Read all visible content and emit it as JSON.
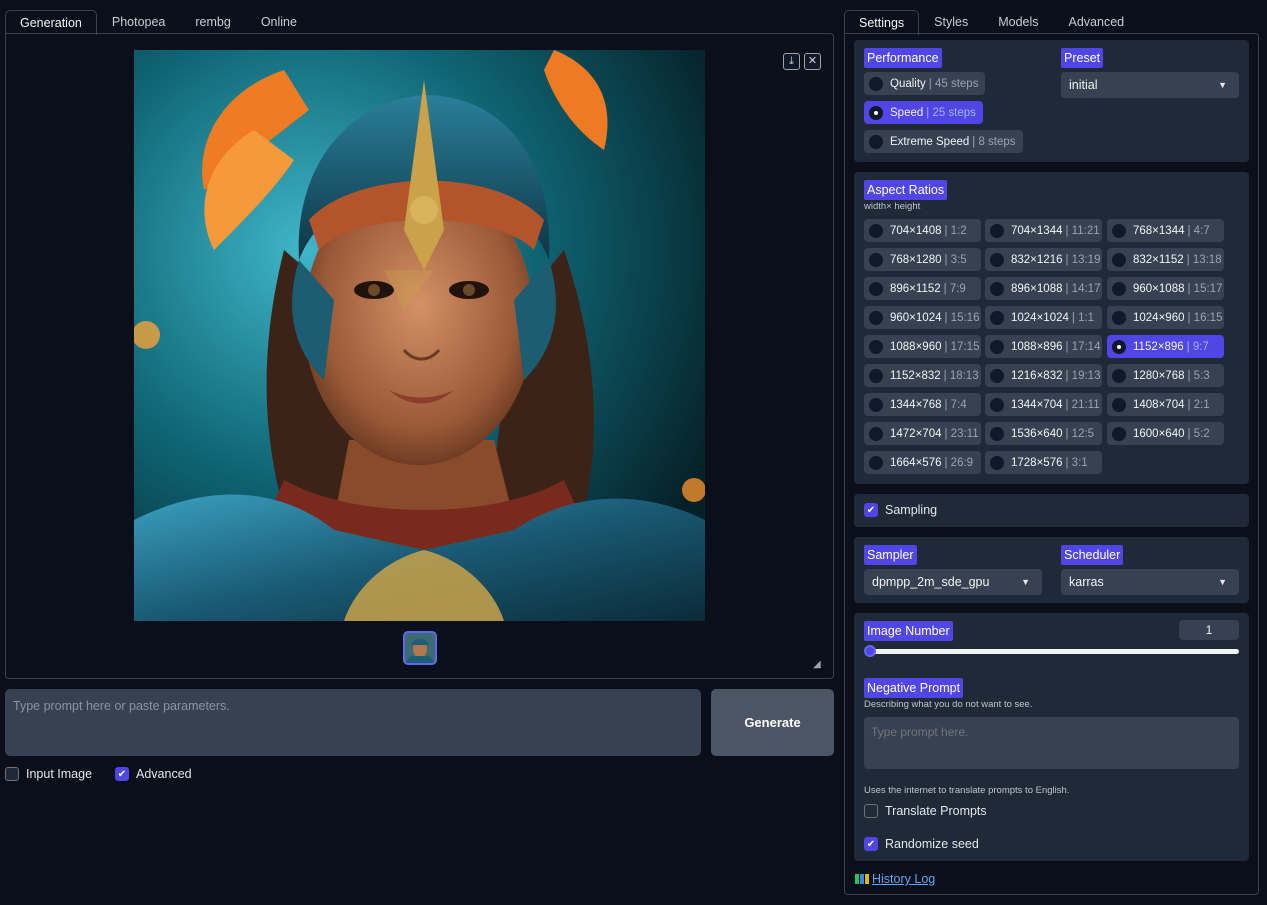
{
  "left_tabs": [
    {
      "label": "Generation",
      "active": true
    },
    {
      "label": "Photopea",
      "active": false
    },
    {
      "label": "rembg",
      "active": false
    },
    {
      "label": "Online",
      "active": false
    }
  ],
  "right_tabs": [
    {
      "label": "Settings",
      "active": true
    },
    {
      "label": "Styles",
      "active": false
    },
    {
      "label": "Models",
      "active": false
    },
    {
      "label": "Advanced",
      "active": false
    }
  ],
  "preview": {
    "download_icon": "download-icon",
    "close_icon": "close-icon"
  },
  "prompt": {
    "placeholder": "Type prompt here or paste parameters.",
    "generate_label": "Generate"
  },
  "options": {
    "input_image_label": "Input Image",
    "input_image_checked": false,
    "advanced_label": "Advanced",
    "advanced_checked": true
  },
  "performance": {
    "label": "Performance",
    "items": [
      {
        "name": "Quality",
        "steps": "| 45 steps",
        "selected": false
      },
      {
        "name": "Speed",
        "steps": "| 25 steps",
        "selected": true
      },
      {
        "name": "Extreme Speed",
        "steps": "| 8 steps",
        "selected": false
      }
    ]
  },
  "preset": {
    "label": "Preset",
    "value": "initial"
  },
  "aspect": {
    "label": "Aspect Ratios",
    "sublabel": "width× height",
    "items": [
      {
        "size": "704×1408",
        "ratio": "| 1:2"
      },
      {
        "size": "704×1344",
        "ratio": "| 11:21"
      },
      {
        "size": "768×1344",
        "ratio": "| 4:7"
      },
      {
        "size": "768×1280",
        "ratio": "| 3:5"
      },
      {
        "size": "832×1216",
        "ratio": "| 13:19"
      },
      {
        "size": "832×1152",
        "ratio": "| 13:18"
      },
      {
        "size": "896×1152",
        "ratio": "| 7:9"
      },
      {
        "size": "896×1088",
        "ratio": "| 14:17"
      },
      {
        "size": "960×1088",
        "ratio": "| 15:17"
      },
      {
        "size": "960×1024",
        "ratio": "| 15:16"
      },
      {
        "size": "1024×1024",
        "ratio": "| 1:1"
      },
      {
        "size": "1024×960",
        "ratio": "| 16:15"
      },
      {
        "size": "1088×960",
        "ratio": "| 17:15"
      },
      {
        "size": "1088×896",
        "ratio": "| 17:14"
      },
      {
        "size": "1152×896",
        "ratio": "| 9:7",
        "selected": true
      },
      {
        "size": "1152×832",
        "ratio": "| 18:13"
      },
      {
        "size": "1216×832",
        "ratio": "| 19:13"
      },
      {
        "size": "1280×768",
        "ratio": "| 5:3"
      },
      {
        "size": "1344×768",
        "ratio": "| 7:4"
      },
      {
        "size": "1344×704",
        "ratio": "| 21:11"
      },
      {
        "size": "1408×704",
        "ratio": "| 2:1"
      },
      {
        "size": "1472×704",
        "ratio": "| 23:11"
      },
      {
        "size": "1536×640",
        "ratio": "| 12:5"
      },
      {
        "size": "1600×640",
        "ratio": "| 5:2"
      },
      {
        "size": "1664×576",
        "ratio": "| 26:9"
      },
      {
        "size": "1728×576",
        "ratio": "| 3:1"
      }
    ]
  },
  "sampling": {
    "label": "Sampling",
    "checked": true
  },
  "sampler": {
    "label": "Sampler",
    "value": "dpmpp_2m_sde_gpu"
  },
  "scheduler": {
    "label": "Scheduler",
    "value": "karras"
  },
  "image_number": {
    "label": "Image Number",
    "value": "1",
    "slider_fraction": 0.0
  },
  "negative": {
    "label": "Negative Prompt",
    "hint": "Describing what you do not want to see.",
    "placeholder": "Type prompt here."
  },
  "translate": {
    "note": "Uses the internet to translate prompts to English.",
    "label": "Translate Prompts",
    "checked": false
  },
  "randomize": {
    "label": "Randomize seed",
    "checked": true
  },
  "history": {
    "label": "History Log",
    "icon": "books-icon"
  },
  "colors": {
    "accent": "#4f46e5",
    "panel": "#1f2937",
    "background": "#0b0f19"
  }
}
